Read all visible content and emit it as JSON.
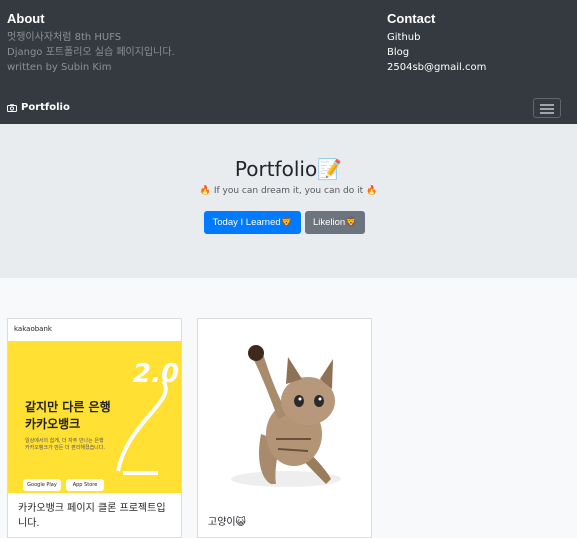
{
  "footer": {
    "about_title": "About",
    "about_lines": [
      "멋쟁이사자처럼 8th HUFS",
      "Django 포트폴리오 실습 페이지입니다.",
      "written by Subin Kim"
    ],
    "contact_title": "Contact",
    "contact_links": [
      "Github",
      "Blog",
      "2504sb@gmail.com"
    ]
  },
  "navbar": {
    "brand": "Portfolio",
    "brand_icon": "camera-icon",
    "toggler_icon": "hamburger-icon"
  },
  "jumbotron": {
    "title": "Portfolio📝",
    "lead": "🔥 If you can dream it, you can do it 🔥",
    "buttons": [
      "Today I Learned🦁",
      "Likelion🦁"
    ]
  },
  "cards": [
    {
      "image": {
        "brand": "kakaobank",
        "headline": [
          "같지만 다른 은행",
          "카카오뱅크"
        ],
        "small": [
          "일상에서의 쉽게, 더 자주 만나는 은행",
          "카카오뱅크가 만든 더 편리해졌습니다."
        ],
        "store_buttons": [
          "Google Play",
          "App Store"
        ],
        "accent_text": "2.0"
      },
      "text": "카카오뱅크 페이지 클론 프로젝트입니다."
    },
    {
      "image": {
        "subject": "kitten"
      },
      "text": "고양이😺"
    }
  ],
  "colors": {
    "navbar_bg": "#343a40",
    "jumbotron_bg": "#e9ecef",
    "primary": "#007bff",
    "secondary": "#6c757d",
    "kakao_yellow": "#ffe033"
  }
}
